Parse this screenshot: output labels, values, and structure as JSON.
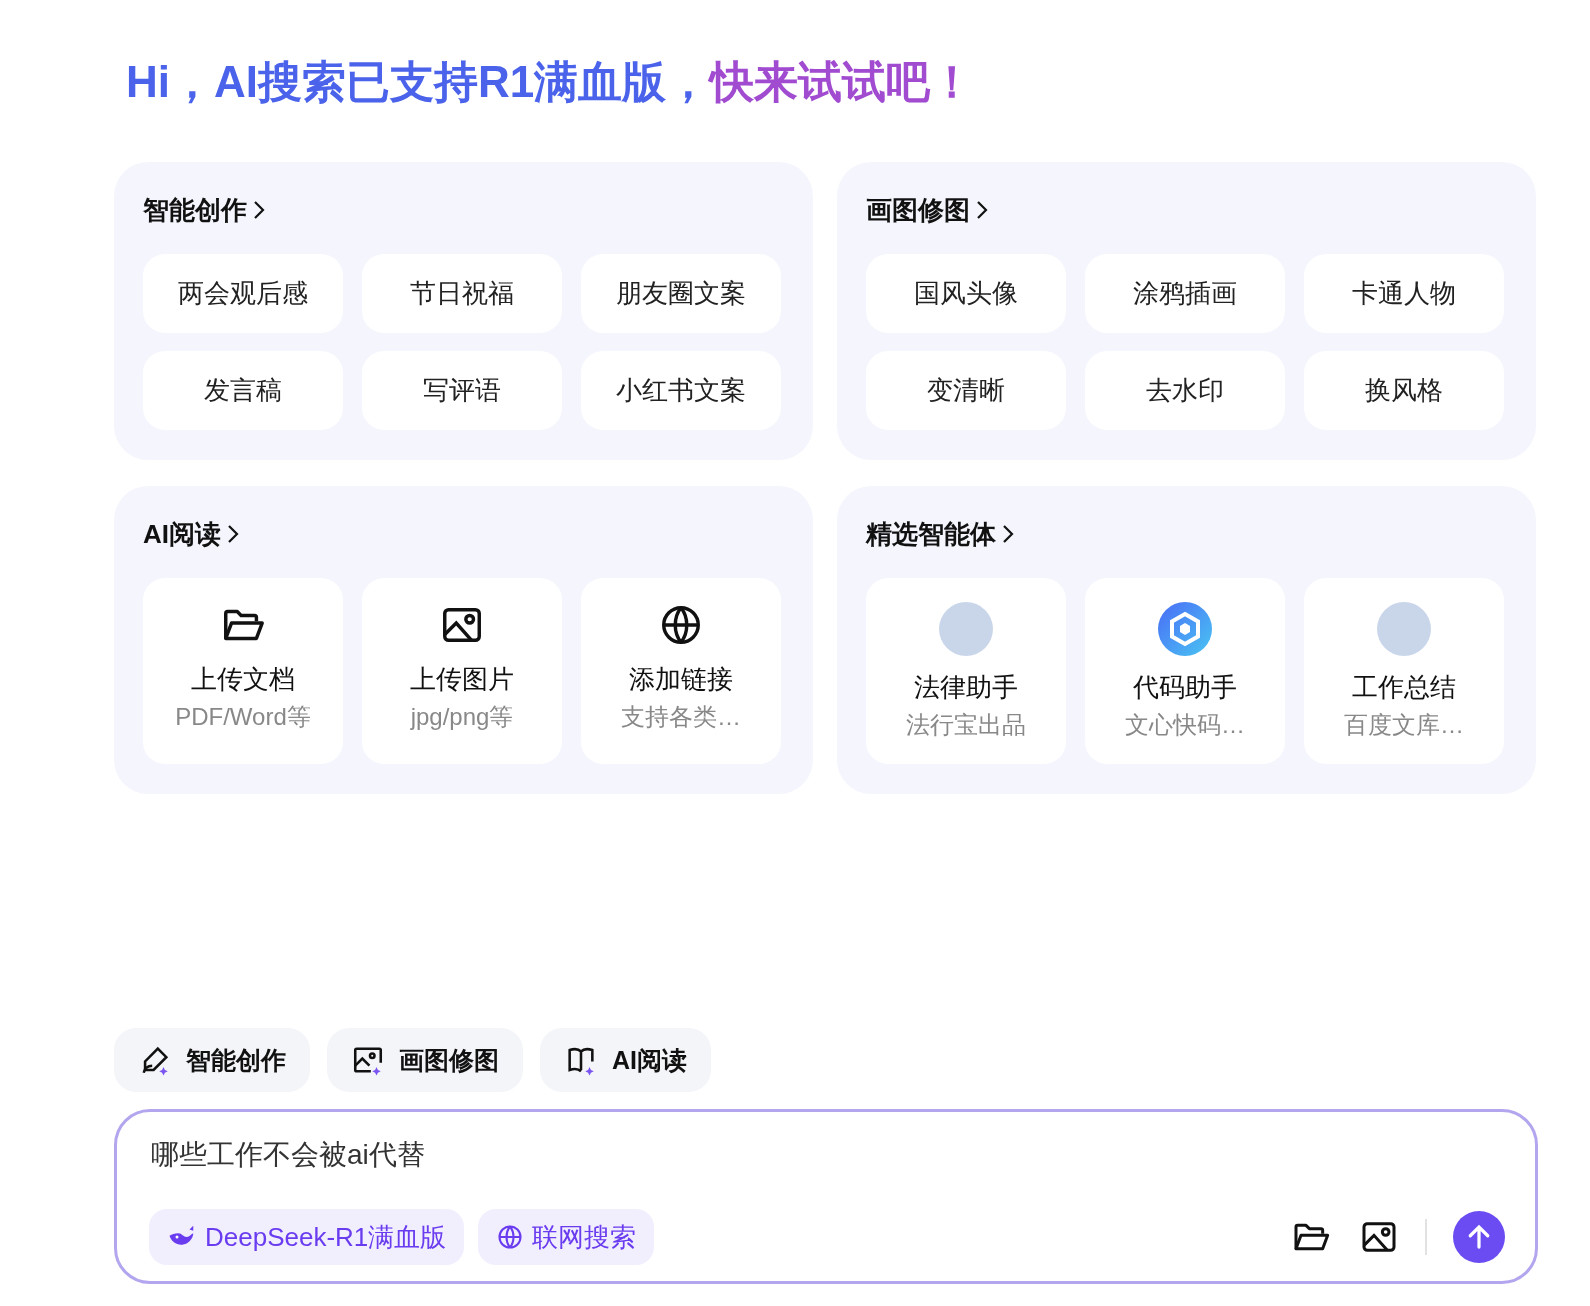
{
  "heading": {
    "lead": "Hi，AI搜索已支持R1满血版，",
    "tail": "快来试试吧！"
  },
  "cards": [
    {
      "title": "智能创作",
      "kind": "pills",
      "items": [
        {
          "label": "两会观后感"
        },
        {
          "label": "节日祝福"
        },
        {
          "label": "朋友圈文案"
        },
        {
          "label": "发言稿"
        },
        {
          "label": "写评语"
        },
        {
          "label": "小红书文案"
        }
      ]
    },
    {
      "title": "画图修图",
      "kind": "pills",
      "items": [
        {
          "label": "国风头像"
        },
        {
          "label": "涂鸦插画"
        },
        {
          "label": "卡通人物"
        },
        {
          "label": "变清晰"
        },
        {
          "label": "去水印"
        },
        {
          "label": "换风格"
        }
      ]
    },
    {
      "title": "AI阅读",
      "kind": "tiles",
      "items": [
        {
          "kind": "folder",
          "label": "上传文档",
          "sub": "PDF/Word等"
        },
        {
          "kind": "image",
          "label": "上传图片",
          "sub": "jpg/png等"
        },
        {
          "kind": "globe",
          "label": "添加链接",
          "sub": "支持各类…"
        }
      ]
    },
    {
      "title": "精选智能体",
      "kind": "tiles",
      "items": [
        {
          "kind": "avatar",
          "label": "法律助手",
          "sub": "法行宝出品"
        },
        {
          "kind": "logo",
          "label": "代码助手",
          "sub": "文心快码…"
        },
        {
          "kind": "avatar",
          "label": "工作总结",
          "sub": "百度文库…"
        }
      ]
    }
  ],
  "shortcuts": [
    {
      "label": "智能创作"
    },
    {
      "label": "画图修图"
    },
    {
      "label": "AI阅读"
    }
  ],
  "input": {
    "value": "哪些工作不会被ai代替"
  },
  "toggles": [
    {
      "label": "DeepSeek-R1满血版",
      "selected": true
    },
    {
      "label": "联网搜索",
      "selected": true
    }
  ]
}
